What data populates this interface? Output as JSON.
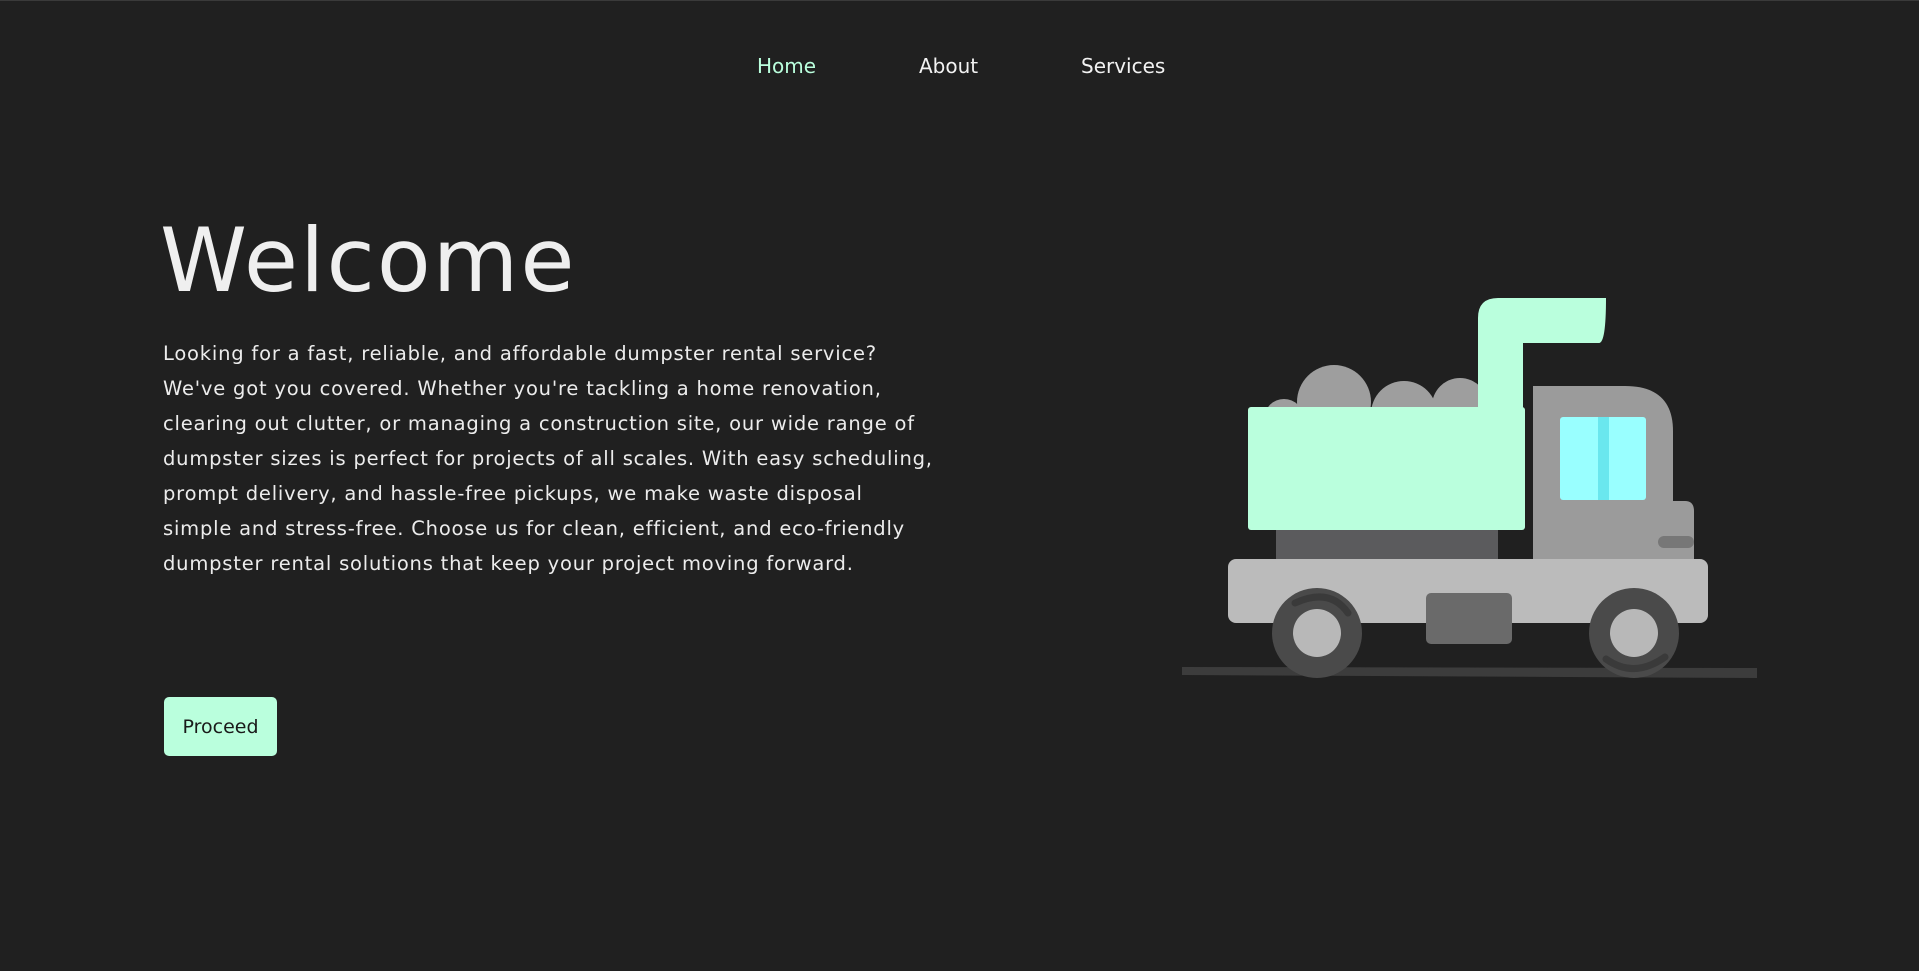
{
  "nav": {
    "items": [
      {
        "label": "Home",
        "active": true
      },
      {
        "label": "About",
        "active": false
      },
      {
        "label": "Services",
        "active": false
      }
    ]
  },
  "hero": {
    "title": "Welcome",
    "description": "Looking for a fast, reliable, and affordable dumpster rental service? We've got you covered. Whether you're tackling a home renovation, clearing out clutter, or managing a construction site, our wide range of dumpster sizes is perfect for projects of all scales. With easy scheduling, prompt delivery, and hassle-free pickups, we make waste disposal simple and stress-free. Choose us for clean, efficient, and eco-friendly dumpster rental solutions that keep your project moving forward.",
    "cta_label": "Proceed"
  },
  "illustration": {
    "icon": "dump-truck-icon"
  },
  "colors": {
    "background": "#202020",
    "accent": "#baffdd",
    "text": "#efefef"
  }
}
